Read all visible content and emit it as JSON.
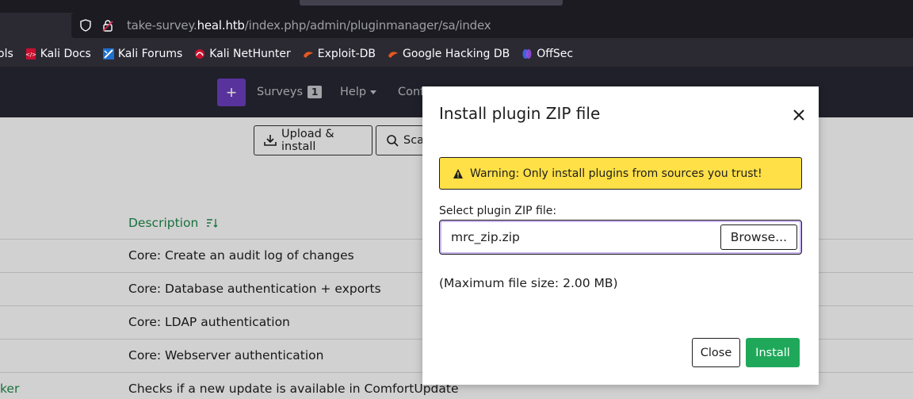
{
  "browser": {
    "url_prefix": "take-survey.",
    "url_host": "heal.htb",
    "url_path": "/index.php/admin/pluginmanager/sa/index",
    "bookmarks": [
      {
        "label": "ols",
        "icon": "none"
      },
      {
        "label": "Kali Docs",
        "icon": "kali-docs-icon"
      },
      {
        "label": "Kali Forums",
        "icon": "kali-forums-icon"
      },
      {
        "label": "Kali NetHunter",
        "icon": "nethunter-icon"
      },
      {
        "label": "Exploit-DB",
        "icon": "exploit-db-icon"
      },
      {
        "label": "Google Hacking DB",
        "icon": "ghdb-icon"
      },
      {
        "label": "OffSec",
        "icon": "offsec-icon"
      }
    ]
  },
  "nav": {
    "plus": "+",
    "surveys_label": "Surveys",
    "surveys_count": "1",
    "help_label": "Help",
    "config_label": "Conf"
  },
  "toolbar": {
    "upload_label": "Upload & install",
    "scan_label": "Sca"
  },
  "table": {
    "description_header": "Description",
    "rows": [
      {
        "left": "",
        "description": "Core: Create an audit log of changes"
      },
      {
        "left": "",
        "description": "Core: Database authentication + exports"
      },
      {
        "left": "",
        "description": "Core: LDAP authentication"
      },
      {
        "left": "",
        "description": "Core: Webserver authentication"
      },
      {
        "left": "ker",
        "description": "Checks if a new update is available in ComfortUpdate"
      }
    ]
  },
  "modal": {
    "title": "Install plugin ZIP file",
    "warning": "Warning: Only install plugins from sources you trust!",
    "field_label": "Select plugin ZIP file:",
    "file_name": "mrc_zip.zip",
    "browse_label": "Browse...",
    "max_size": "(Maximum file size: 2.00 MB)",
    "close_label": "Close",
    "install_label": "Install"
  },
  "colors": {
    "accent_purple": "#6d3fbf",
    "install_green": "#1fa85a",
    "warning_yellow": "#ffe046",
    "header_green": "#1f8a4c"
  }
}
